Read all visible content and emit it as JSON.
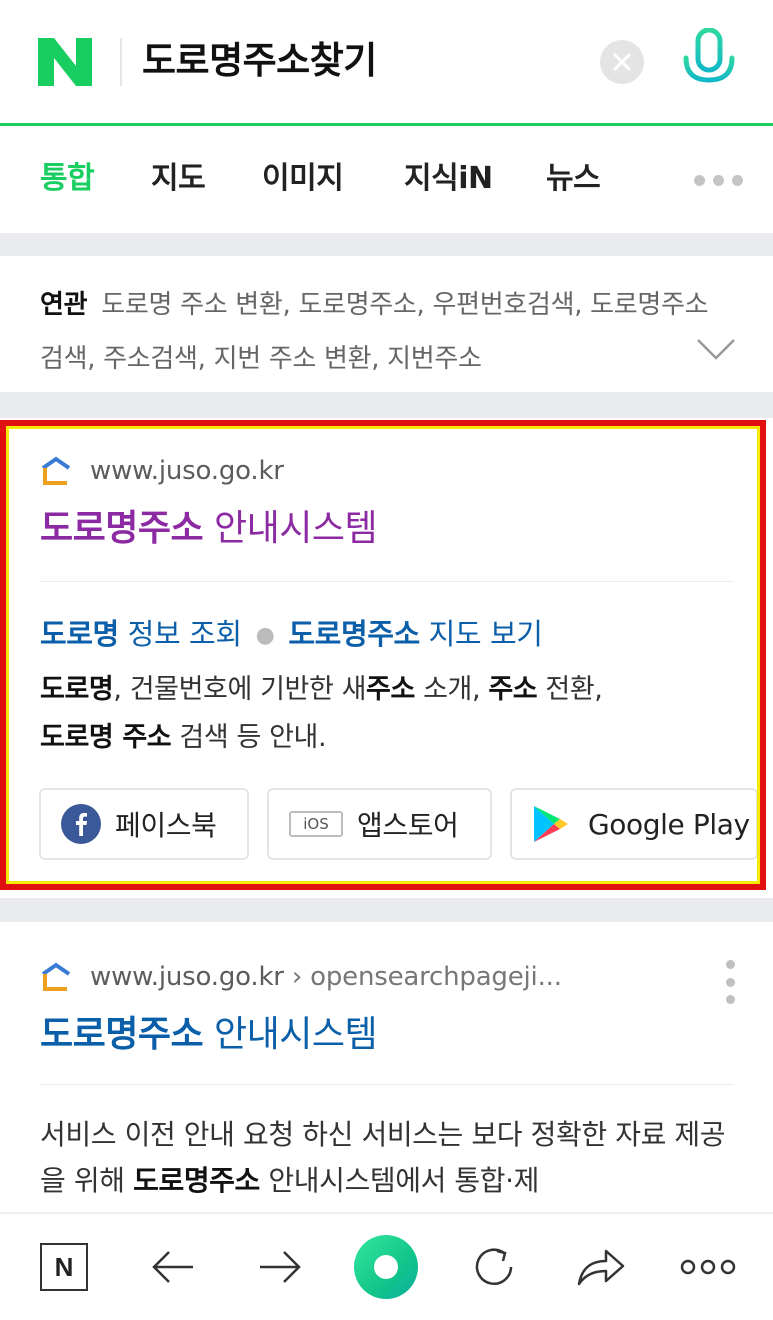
{
  "search": {
    "logo": "N",
    "query": "도로명주소찾기"
  },
  "tabs": [
    {
      "label": "통합",
      "active": true
    },
    {
      "label": "지도",
      "active": false
    },
    {
      "label": "이미지",
      "active": false
    },
    {
      "label": "지식iN",
      "active": false
    },
    {
      "label": "뉴스",
      "active": false
    }
  ],
  "related": {
    "label": "연관",
    "terms": "도로명 주소 변환, 도로명주소, 우편번호검색, 도로명주소 검색, 주소검색, 지번 주소 변환, 지번주소"
  },
  "result1": {
    "url": "www.juso.go.kr",
    "title_bold": "도로명주소",
    "title_rest": " 안내시스템",
    "sublink1_bold": "도로명",
    "sublink1_rest": " 정보 조회",
    "sublink2_bold": "도로명주소",
    "sublink2_rest": " 지도 보기",
    "desc": {
      "p1": "도로명",
      "p2": ", 건물번호에 기반한 새",
      "p3": "주소",
      "p4": " 소개, ",
      "p5": "주소",
      "p6": " 전환,",
      "p7": "도로명 주소",
      "p8": " 검색 등 안내."
    },
    "apps": [
      {
        "label": "페이스북",
        "icon": "facebook-icon"
      },
      {
        "label": "앱스토어",
        "icon": "ios-icon",
        "badge": "iOS"
      },
      {
        "label": "Google Play",
        "icon": "google-play-icon"
      }
    ]
  },
  "result2": {
    "url": "www.juso.go.kr",
    "crumb": "opensearchpageji...",
    "title_bold": "도로명주소",
    "title_rest": " 안내시스템",
    "desc": {
      "p1": "서비스 이전 안내 요청 하신 서비스는 보다 정확한 자료 제공을 위해 ",
      "p2": "도로명주소",
      "p3": " 안내시스템에서 통합·제"
    }
  },
  "colors": {
    "brand_green": "#19ce60",
    "link_blue": "#0b5fa8",
    "visited_purple": "#8b2aa2",
    "highlight_red": "#e01010",
    "highlight_yellow": "#f5ea00"
  },
  "bottom_nav": {
    "home_label": "N",
    "icons": [
      "naver-home-icon",
      "back-arrow-icon",
      "forward-arrow-icon",
      "green-dot-icon",
      "refresh-icon",
      "share-icon",
      "more-icon"
    ]
  }
}
